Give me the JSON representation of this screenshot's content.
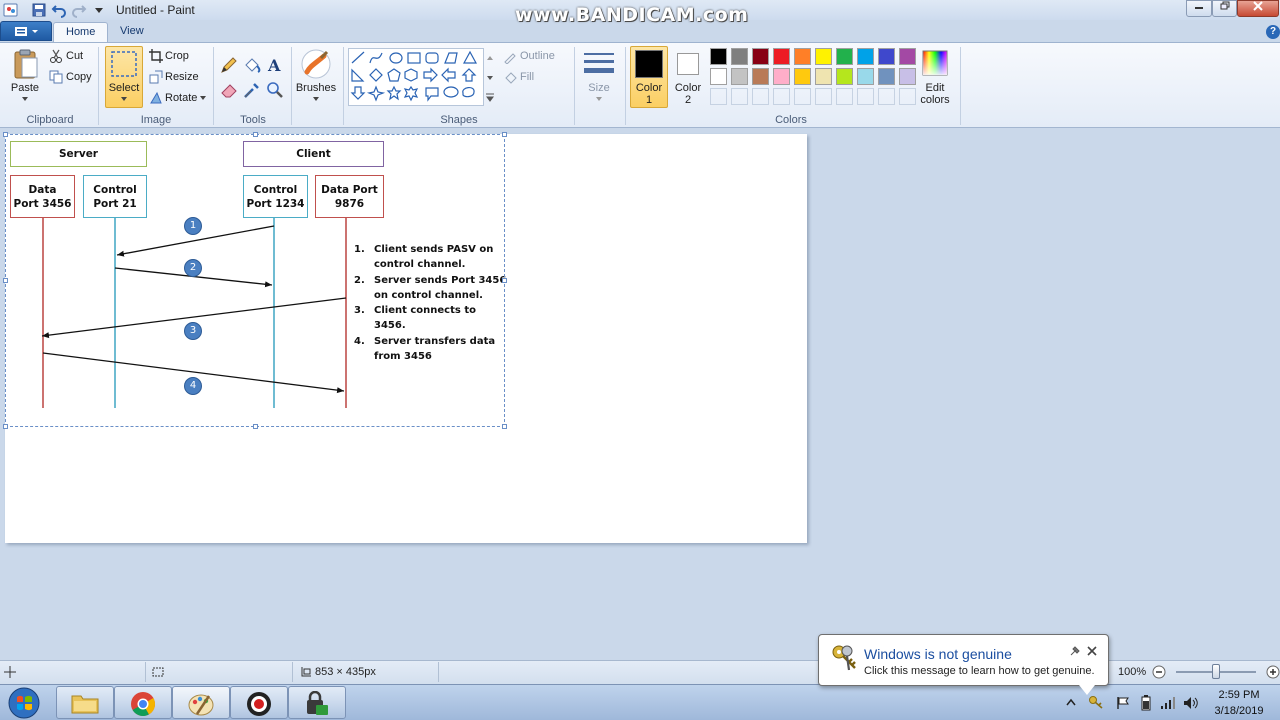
{
  "window": {
    "title": "Untitled - Paint",
    "watermark": "www.BANDICAM.com",
    "controls": [
      "minimize",
      "restore",
      "close"
    ]
  },
  "ribbon": {
    "tabs": [
      {
        "label": "Home",
        "active": true
      },
      {
        "label": "View",
        "active": false
      }
    ],
    "clipboard": {
      "paste": "Paste",
      "cut": "Cut",
      "copy": "Copy",
      "group": "Clipboard"
    },
    "image": {
      "select": "Select",
      "crop": "Crop",
      "resize": "Resize",
      "rotate": "Rotate",
      "group": "Image"
    },
    "tools": {
      "group": "Tools",
      "items": [
        "pencil-icon",
        "fill-icon",
        "text-icon",
        "eraser-icon",
        "color-picker-icon",
        "magnifier-icon"
      ]
    },
    "brushes": {
      "label": "Brushes"
    },
    "shapes": {
      "group": "Shapes",
      "outline": "Outline",
      "fill": "Fill"
    },
    "size": {
      "label": "Size"
    },
    "colors": {
      "group": "Colors",
      "color1_label": "Color",
      "color1_num": "1",
      "color2_label": "Color",
      "color2_num": "2",
      "edit_colors_line1": "Edit",
      "edit_colors_line2": "colors",
      "color1_value": "#000000",
      "color2_value": "#ffffff",
      "palette_row1": [
        "#000000",
        "#7f7f7f",
        "#880015",
        "#ed1c24",
        "#ff7f27",
        "#fff200",
        "#22b14c",
        "#00a2e8",
        "#3f48cc",
        "#a349a4"
      ],
      "palette_row2": [
        "#ffffff",
        "#c3c3c3",
        "#b97a57",
        "#ffaec9",
        "#ffc90e",
        "#efe4b0",
        "#b5e61d",
        "#99d9ea",
        "#7092be",
        "#c8bfe7"
      ]
    }
  },
  "diagram": {
    "server_header": "Server",
    "client_header": "Client",
    "server_data_line1": "Data",
    "server_data_line2": "Port 3456",
    "server_control_line1": "Control",
    "server_control_line2": "Port 21",
    "client_control_line1": "Control",
    "client_control_line2": "Port 1234",
    "client_data_line1": "Data Port",
    "client_data_line2": "9876",
    "step_labels": [
      "1",
      "2",
      "3",
      "4"
    ],
    "colors": {
      "server_header": "#9bbb59",
      "client_header": "#8064a2",
      "data_port": "#c0504d",
      "control_port": "#4bacc6",
      "step_circle": "#4a7fc1"
    },
    "steps": [
      {
        "num": "1.",
        "line1": "Client sends PASV on",
        "line2": "control channel."
      },
      {
        "num": "2.",
        "line1": "Server sends Port 3456",
        "line2": "on control channel."
      },
      {
        "num": "3.",
        "line1": "Client connects to 3456.",
        "line2": ""
      },
      {
        "num": "4.",
        "line1": "Server transfers data",
        "line2": "from 3456"
      }
    ]
  },
  "status": {
    "selection_size": "853 × 435px",
    "zoom": "100%"
  },
  "notification": {
    "title": "Windows is not genuine",
    "message": "Click this message to learn how to get genuine."
  },
  "taskbar": {
    "time": "2:59 PM",
    "date": "3/18/2019",
    "apps": [
      "start-button",
      "file-explorer",
      "chrome",
      "paint",
      "bandicam",
      "security-app"
    ]
  }
}
